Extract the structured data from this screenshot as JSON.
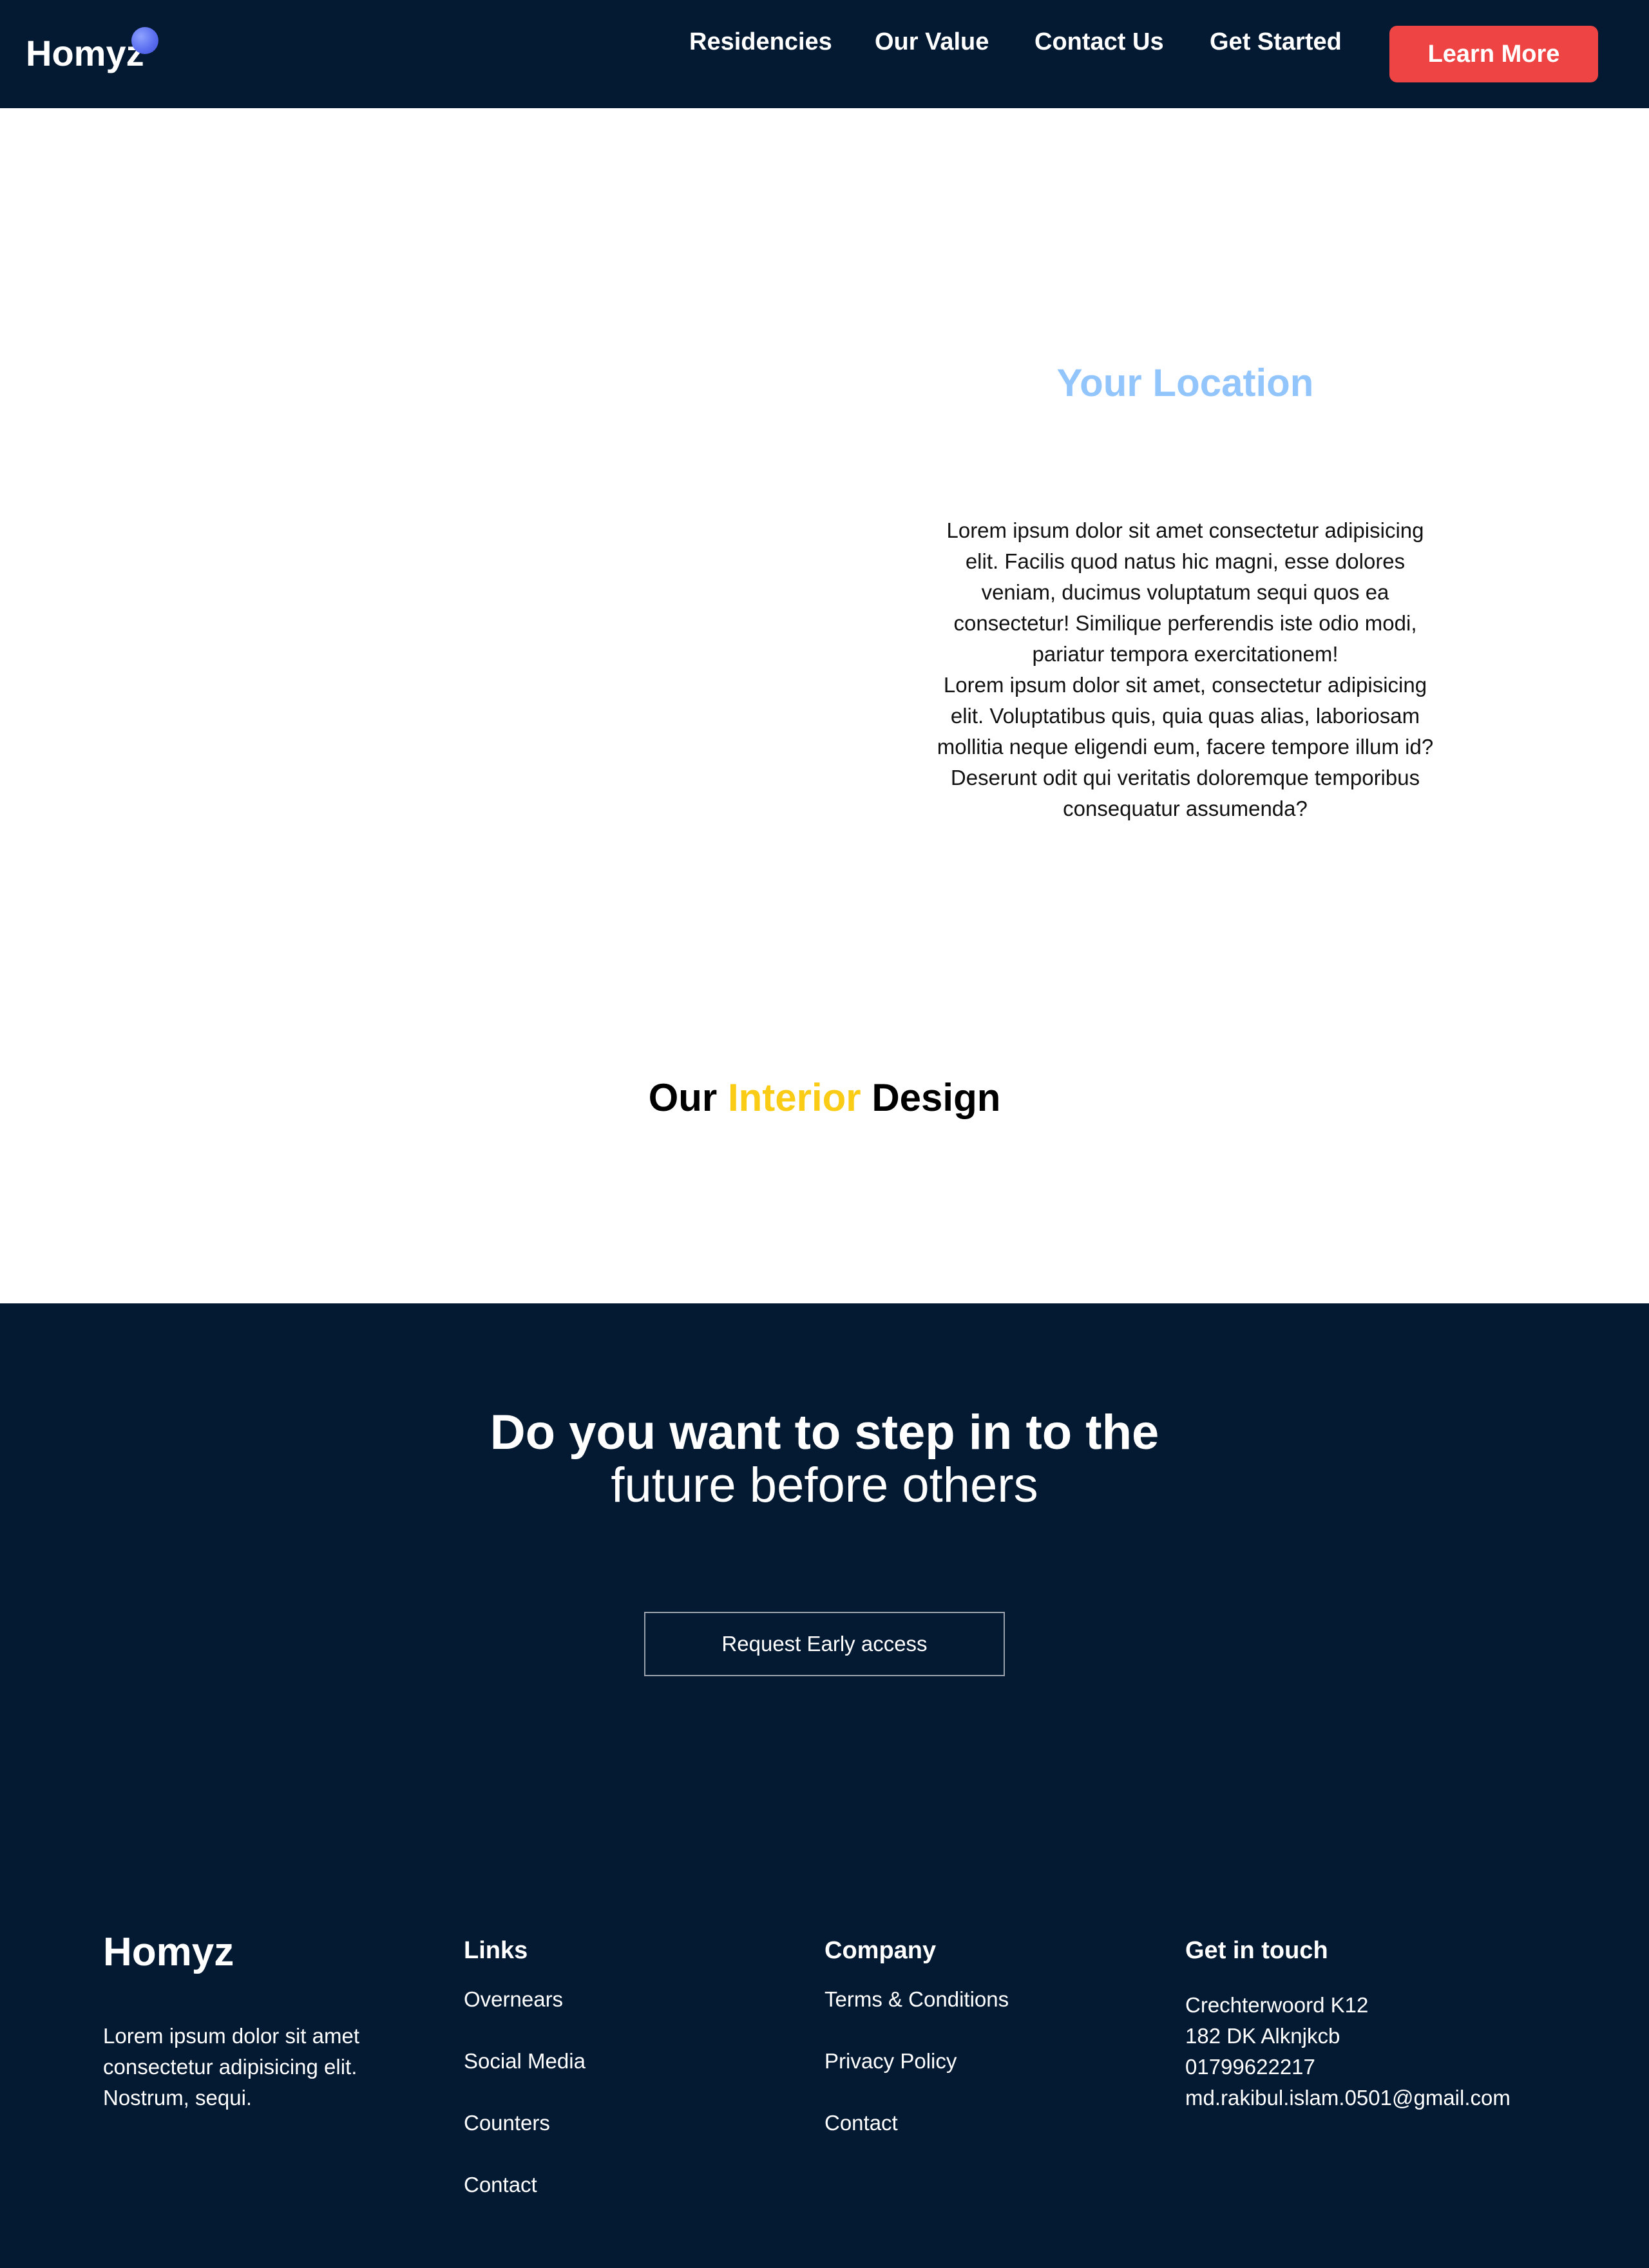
{
  "header": {
    "logo_text": "Homyz",
    "nav": [
      "Residencies",
      "Our Value",
      "Contact Us",
      "Get Started"
    ],
    "cta_label": "Learn More"
  },
  "location": {
    "title": "Your Location",
    "lines": [
      "Lorem ipsum dolor sit amet consectetur adipisicing",
      "elit. Facilis quod natus hic magni, esse dolores",
      "veniam, ducimus voluptatum sequi quos ea",
      "consectetur! Similique perferendis iste odio modi,",
      "pariatur tempora exercitationem!",
      "Lorem ipsum dolor sit amet, consectetur adipisicing",
      "elit. Voluptatibus quis, quia quas alias, laboriosam",
      "mollitia neque eligendi eum, facere tempore illum id?",
      "Deserunt odit qui veritatis doloremque temporibus",
      "consequatur assumenda?"
    ]
  },
  "interior": {
    "prefix": "Our ",
    "accent": "Interior",
    "suffix": " Design",
    "accent_color": "#facc15"
  },
  "cta": {
    "line1": "Do you want to step in to the",
    "line2": "future before others",
    "button_label": "Request Early access"
  },
  "footer": {
    "brand": "Homyz",
    "description": "Lorem ipsum dolor sit amet consectetur adipisicing elit. Nostrum, sequi.",
    "links_heading": "Links",
    "links": [
      "Overnears",
      "Social Media",
      "Counters",
      "Contact"
    ],
    "company_heading": "Company",
    "company": [
      "Terms & Conditions",
      "Privacy Policy",
      "Contact"
    ],
    "contact_heading": "Get in touch",
    "contact": [
      "Crechterwoord K12",
      "182 DK Alknjkcb",
      "01799622217",
      "md.rakibul.islam.0501@gmail.com"
    ]
  },
  "colors": {
    "navy": "#041a33",
    "button_red": "#ef4444",
    "location_title": "#93c5fd",
    "accent_yellow": "#facc15"
  }
}
